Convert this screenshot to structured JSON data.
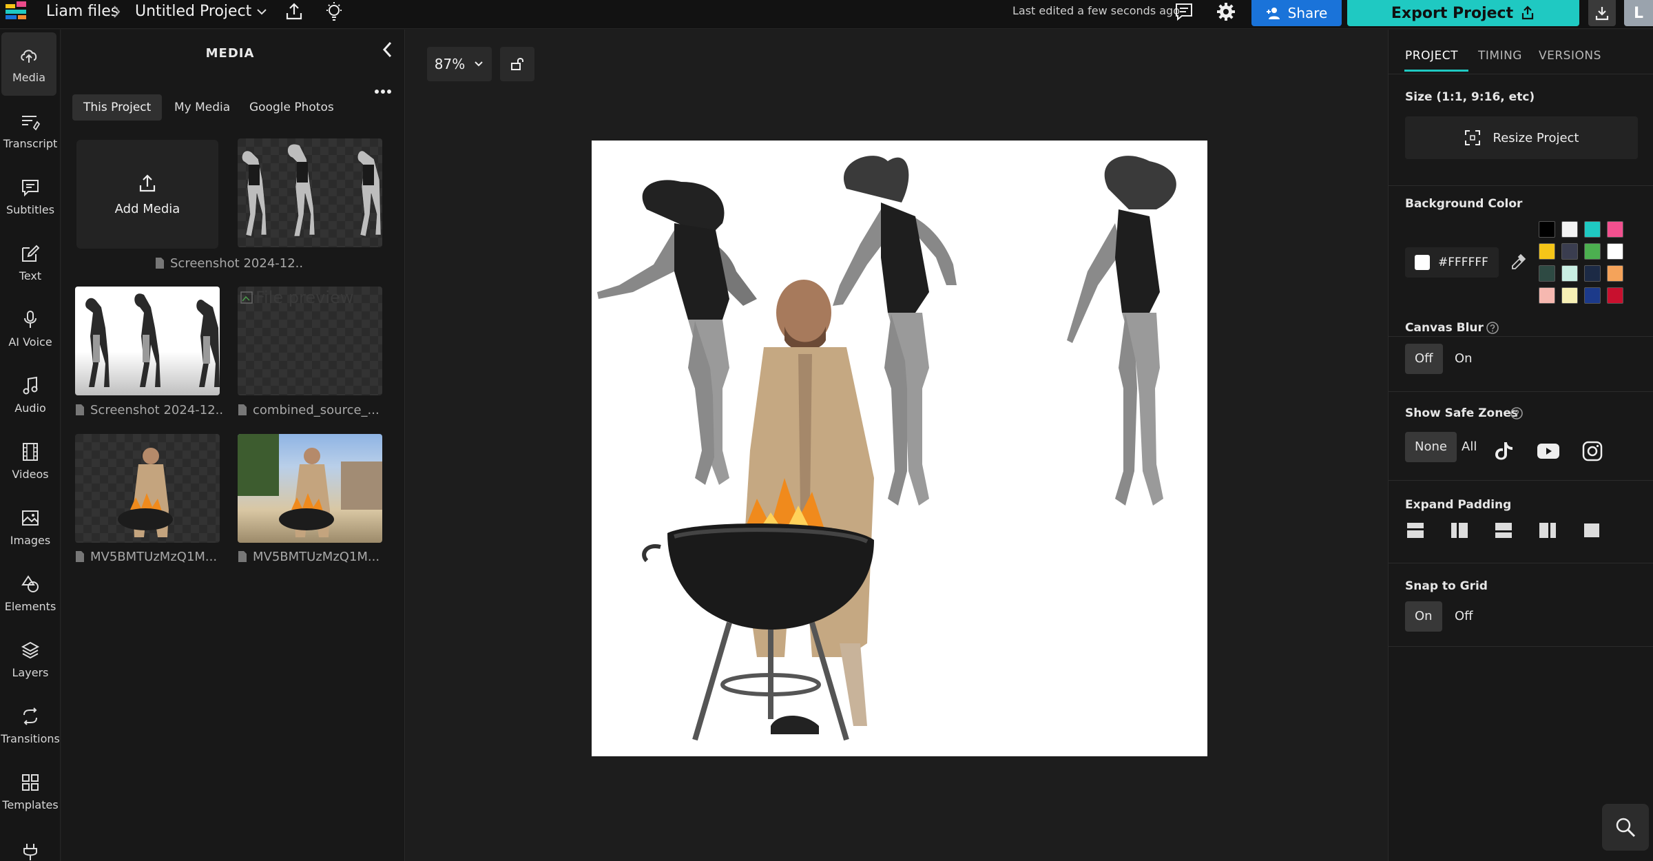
{
  "topbar": {
    "breadcrumb_root": "Liam files",
    "project_name": "Untitled Project",
    "last_edited": "Last edited a few seconds ago",
    "share_label": "Share",
    "export_label": "Export Project",
    "avatar_initial": "L"
  },
  "leftnav": {
    "items": [
      {
        "label": "Media",
        "icon": "cloud-upload-icon"
      },
      {
        "label": "Transcript",
        "icon": "transcript-icon"
      },
      {
        "label": "Subtitles",
        "icon": "subtitles-icon"
      },
      {
        "label": "Text",
        "icon": "text-edit-icon"
      },
      {
        "label": "AI Voice",
        "icon": "microphone-icon"
      },
      {
        "label": "Audio",
        "icon": "music-note-icon"
      },
      {
        "label": "Videos",
        "icon": "film-icon"
      },
      {
        "label": "Images",
        "icon": "image-icon"
      },
      {
        "label": "Elements",
        "icon": "shapes-icon"
      },
      {
        "label": "Layers",
        "icon": "layers-icon"
      },
      {
        "label": "Transitions",
        "icon": "transitions-icon"
      },
      {
        "label": "Templates",
        "icon": "templates-icon"
      }
    ]
  },
  "media_panel": {
    "title": "MEDIA",
    "tabs": [
      "This Project",
      "My Media",
      "Google Photos"
    ],
    "active_tab": "This Project",
    "add_media_label": "Add Media",
    "broken_preview_alt": "File preview",
    "files": [
      {
        "name": "Screenshot 2024-12...",
        "kind": "cutout-dancers"
      },
      {
        "name": "Screenshot 2024-12...",
        "kind": "dancers"
      },
      {
        "name": "combined_source_...",
        "kind": "broken"
      },
      {
        "name": "MV5BMTUzMzQ1M...",
        "kind": "cutout-man"
      },
      {
        "name": "MV5BMTUzMzQ1M...",
        "kind": "man-outdoor"
      }
    ]
  },
  "canvas": {
    "zoom_label": "87%"
  },
  "right_panel": {
    "tabs": [
      "PROJECT",
      "TIMING",
      "VERSIONS"
    ],
    "active_tab": "PROJECT",
    "size_label": "Size (1:1, 9:16, etc)",
    "resize_label": "Resize Project",
    "bg_color_label": "Background Color",
    "bg_color_value": "#FFFFFF",
    "swatches": [
      "#000000",
      "#f2f2f2",
      "#1fc9c2",
      "#f2508f",
      "#f5c518",
      "#3a3d4f",
      "#4caf50",
      "#ffffff",
      "#2e4a43",
      "#c9eee3",
      "#1c2a45",
      "#f5a35a",
      "#f6b8b0",
      "#f7f0b5",
      "#1c3a8a",
      "#c8102e"
    ],
    "canvas_blur_label": "Canvas Blur",
    "canvas_blur_options": [
      "Off",
      "On"
    ],
    "canvas_blur_selected": "Off",
    "safe_zones_label": "Show Safe Zones",
    "safe_zones_options": [
      "None",
      "All"
    ],
    "safe_zones_selected": "None",
    "expand_padding_label": "Expand Padding",
    "snap_grid_label": "Snap to Grid",
    "snap_grid_options": [
      "On",
      "Off"
    ],
    "snap_grid_selected": "On"
  }
}
